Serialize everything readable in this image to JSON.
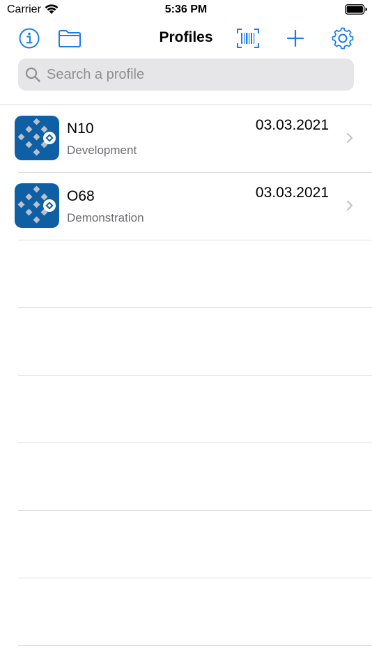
{
  "status_bar": {
    "carrier": "Carrier",
    "time": "5:36 PM"
  },
  "nav": {
    "title": "Profiles",
    "left_icons": [
      "info-icon",
      "folder-icon"
    ],
    "right_icons": [
      "barcode-scan-icon",
      "plus-icon",
      "gear-icon"
    ],
    "accent_color": "#1a7cf0"
  },
  "search": {
    "placeholder": "Search a profile",
    "value": ""
  },
  "profiles": [
    {
      "name": "N10",
      "subtitle": "Development",
      "date": "03.03.2021",
      "icon": "profile-app-icon"
    },
    {
      "name": "O68",
      "subtitle": "Demonstration",
      "date": "03.03.2021",
      "icon": "profile-app-icon"
    }
  ],
  "colors": {
    "icon_bg": "#0f5fa5",
    "icon_diamond": "#b9c2cc",
    "separator": "#dcdcde",
    "subtitle": "#6d6d72",
    "chevron": "#c4c4c7"
  }
}
